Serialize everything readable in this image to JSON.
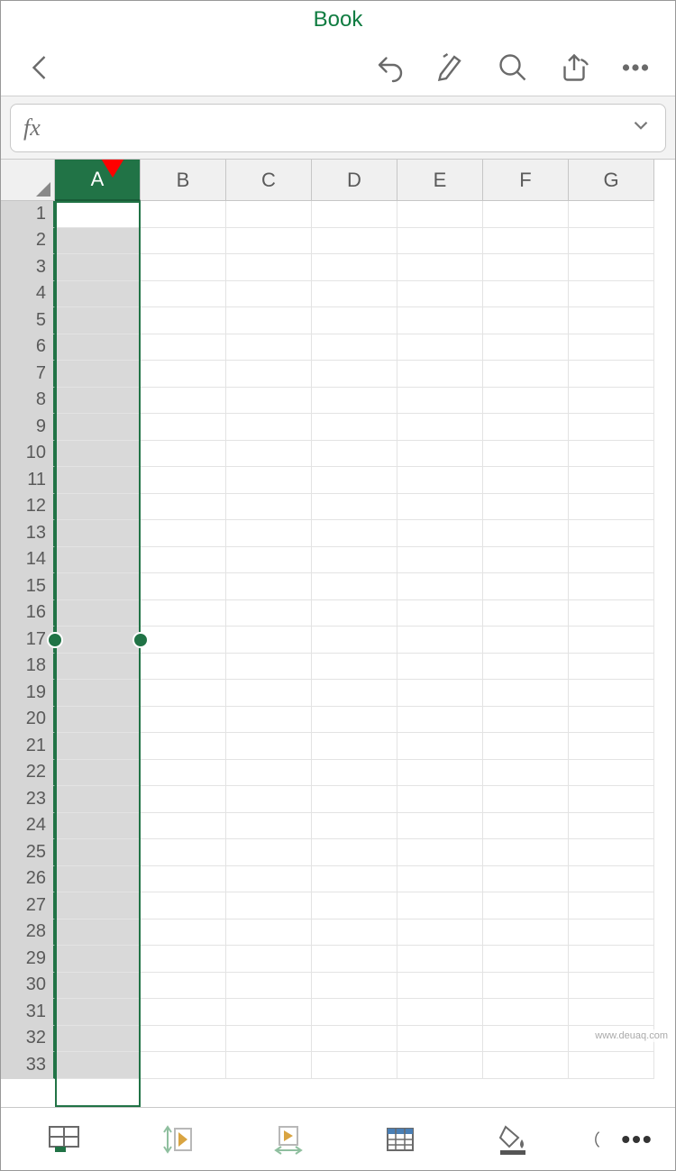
{
  "title": "Book",
  "formula_bar": {
    "fx_label": "fx",
    "value": ""
  },
  "columns": [
    "A",
    "B",
    "C",
    "D",
    "E",
    "F",
    "G"
  ],
  "rows": [
    1,
    2,
    3,
    4,
    5,
    6,
    7,
    8,
    9,
    10,
    11,
    12,
    13,
    14,
    15,
    16,
    17,
    18,
    19,
    20,
    21,
    22,
    23,
    24,
    25,
    26,
    27,
    28,
    29,
    30,
    31,
    32,
    33
  ],
  "selected_column": "A",
  "active_cell": "A1",
  "handle_row": 17,
  "icons": {
    "back": "back-icon",
    "undo": "undo-icon",
    "edit": "edit-pen-icon",
    "search": "search-icon",
    "share": "share-icon",
    "more": "more-icon",
    "sheet": "sheet-tab-icon",
    "autofit_h": "autofit-height-icon",
    "autofit_w": "autofit-width-icon",
    "table_style": "table-style-icon",
    "fill": "fill-bucket-icon",
    "partial": "partial-circle-icon"
  },
  "colors": {
    "accent": "#217346",
    "accent_dark": "#185c37",
    "arrow": "#ff0000"
  },
  "watermark": "www.deuaq.com"
}
